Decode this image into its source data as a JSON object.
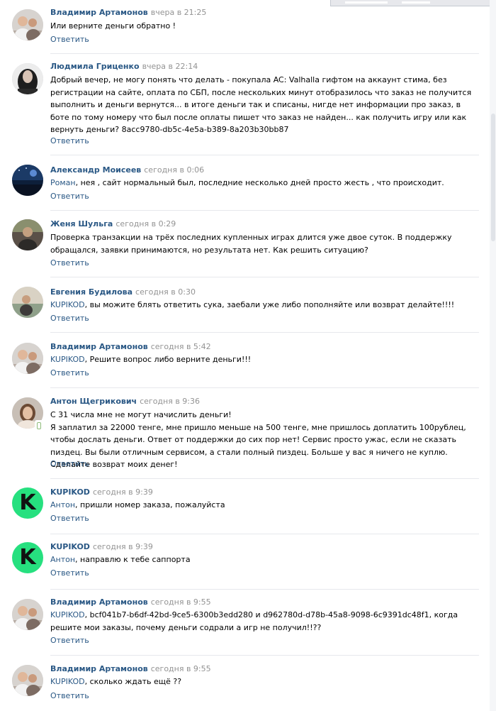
{
  "comments": [
    {
      "author": "Владимир Артамонов",
      "time": "вчера в 21:25",
      "reply_to": "",
      "text": "Или верните деньги обратно !",
      "reply_label": "Ответить",
      "avatar_icon": "user-photo-icon"
    },
    {
      "author": "Людмила Гриценко",
      "time": "вчера в 22:14",
      "reply_to": "",
      "text": "Добрый вечер, не могу понять что делать - покупала AC: Valhalla гифтом на аккаунт стима, без регистрации на сайте, оплата по СБП, после нескольких минут отобразилось что заказ не получится выполнить и деньги вернутся... в итоге деньги так и списаны, нигде нет информации про заказ, в боте по тому номеру что был после оплаты пишет что заказ не найден... как получить игру или как вернуть деньги? 8acc9780-db5c-4e5a-b389-8a203b30bb87",
      "reply_label": "Ответить",
      "avatar_icon": "user-photo-icon"
    },
    {
      "author": "Александр Моисеев",
      "time": "сегодня в 0:06",
      "reply_to": "Роман",
      "text": ", нея , сайт нормальный был, последние несколько дней просто жесть , что происходит.",
      "reply_label": "Ответить",
      "avatar_icon": "user-photo-icon"
    },
    {
      "author": "Женя Шульга",
      "time": "сегодня в 0:29",
      "reply_to": "",
      "text": "Проверка транзакции на трёх последних купленных играх длится уже двое суток. В поддержку обращался, заявки принимаются, но результата нет. Как решить ситуацию?",
      "reply_label": "Ответить",
      "avatar_icon": "user-photo-icon"
    },
    {
      "author": "Евгения Будилова",
      "time": "сегодня в 0:30",
      "reply_to": "KUPIKOD",
      "text": ", вы можите блять ответить сука, заебали уже либо пополняйте или возврат делайте!!!!",
      "reply_label": "Ответить",
      "avatar_icon": "user-photo-icon"
    },
    {
      "author": "Владимир Артамонов",
      "time": "сегодня в 5:42",
      "reply_to": "KUPIKOD",
      "text": ", Решите вопрос либо верните деньги!!!",
      "reply_label": "Ответить",
      "avatar_icon": "user-photo-icon"
    },
    {
      "author": "Антон Щегрикович",
      "time": "сегодня в 9:36",
      "reply_to": "",
      "text": "С 31 числа мне не могут начислить деньги!\nЯ заплатил за 22000 тенге, мне пришло меньше на 500 тенге, мне пришлось доплатить 100рублец, чтобы дослать деньги. Ответ от поддержки до сих пор нет! Сервис просто ужас, если не сказать пиздец. Вы были отличным сервисом, а стали полный пиздец. Больше у вас я ничего не куплю. Сделайте возврат моих денег!",
      "reply_label": "Ответить",
      "avatar_icon": "user-photo-icon"
    },
    {
      "author": "KUPIKOD",
      "time": "сегодня в 9:39",
      "reply_to": "Антон",
      "text": ", пришли номер заказа, пожалуйста",
      "reply_label": "Ответить",
      "avatar_icon": "kupikod-logo",
      "logo_letter": "K"
    },
    {
      "author": "KUPIKOD",
      "time": "сегодня в 9:39",
      "reply_to": "Антон",
      "text": ", направлю к тебе саппорта",
      "reply_label": "Ответить",
      "avatar_icon": "kupikod-logo",
      "logo_letter": "K"
    },
    {
      "author": "Владимир Артамонов",
      "time": "сегодня в 9:55",
      "reply_to": "KUPIKOD",
      "text": ", bcf041b7-b6df-42bd-9ce5-6300b3edd280 и d962780d-d78b-45a8-9098-6c9391dc48f1, когда решите мои заказы, почему деньги содрали а игр не получил!!??",
      "reply_label": "Ответить",
      "avatar_icon": "user-photo-icon"
    },
    {
      "author": "Владимир Артамонов",
      "time": "сегодня в 9:55",
      "reply_to": "KUPIKOD",
      "text": ", сколько ждать ещё ??",
      "reply_label": "Ответить",
      "avatar_icon": "user-photo-icon"
    }
  ],
  "colors": {
    "link": "#2a5885",
    "muted": "#939393",
    "kupikod_green": "#26e07f",
    "separator": "#e7e8ec"
  }
}
